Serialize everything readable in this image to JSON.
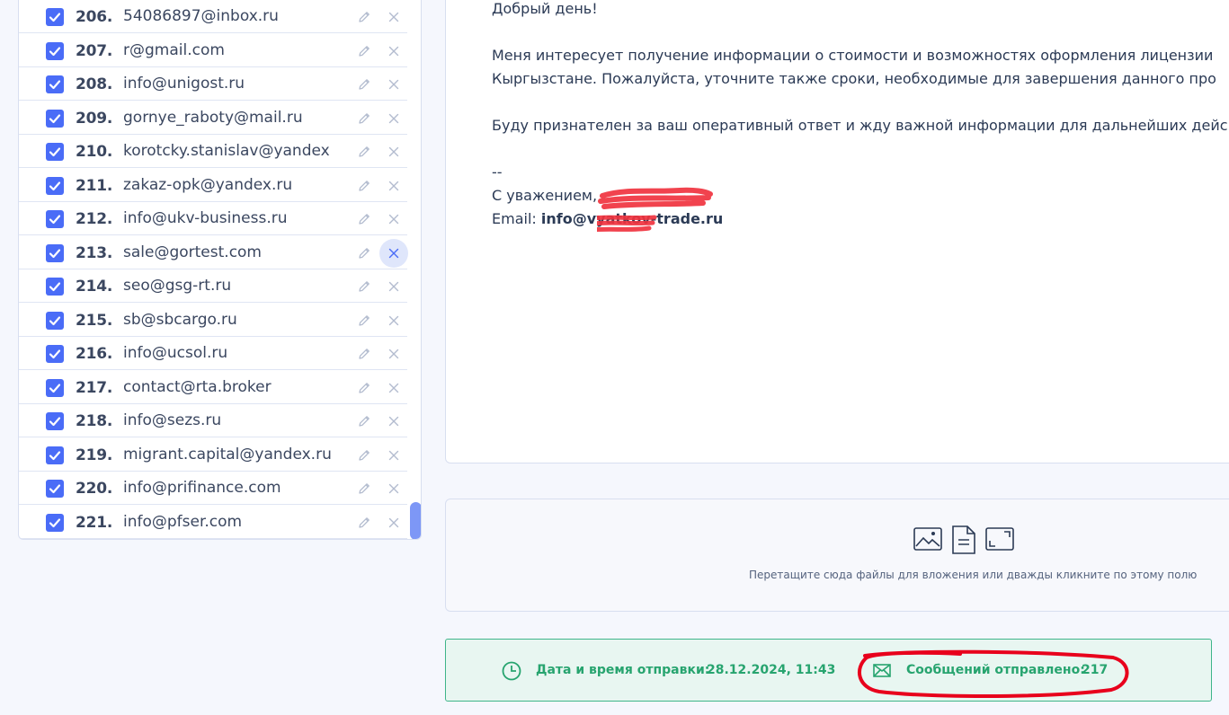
{
  "recipients": {
    "rows": [
      {
        "num": "206.",
        "email": "54086897@inbox.ru"
      },
      {
        "num": "207.",
        "email": "r@gmail.com"
      },
      {
        "num": "208.",
        "email": "info@unigost.ru"
      },
      {
        "num": "209.",
        "email": "gornye_raboty@mail.ru"
      },
      {
        "num": "210.",
        "email": "korotcky.stanislav@yandex"
      },
      {
        "num": "211.",
        "email": "zakaz-opk@yandex.ru"
      },
      {
        "num": "212.",
        "email": "info@ukv-business.ru"
      },
      {
        "num": "213.",
        "email": "sale@gortest.com"
      },
      {
        "num": "214.",
        "email": "seo@gsg-rt.ru"
      },
      {
        "num": "215.",
        "email": "sb@sbcargo.ru"
      },
      {
        "num": "216.",
        "email": "info@ucsol.ru"
      },
      {
        "num": "217.",
        "email": "contact@rta.broker"
      },
      {
        "num": "218.",
        "email": "info@sezs.ru"
      },
      {
        "num": "219.",
        "email": "migrant.capital@yandex.ru"
      },
      {
        "num": "220.",
        "email": "info@prifinance.com"
      },
      {
        "num": "221.",
        "email": "info@pfser.com"
      }
    ],
    "hovered_row_num": "213."
  },
  "message": {
    "greeting": "Добрый день!",
    "para1_line1": "Меня интересует получение информации о стоимости и возможностях оформления лицензии",
    "para1_line2": "Кыргызстане. Пожалуйста, уточните также сроки, необходимые для завершения данного про",
    "para2": "Буду признателен за ваш оперативный ответ и жду важной информации для дальнейших дейс",
    "sig_sep": "--",
    "sig_regards": "С уважением,",
    "sig_email_label": "Email:",
    "sig_email_value": "info@vyatkov-trade.ru"
  },
  "attachments": {
    "hint": "Перетащите сюда файлы для вложения или дважды кликните по этому полю",
    "icons": [
      "image-icon",
      "document-icon",
      "expand-icon"
    ]
  },
  "status": {
    "sent_time_label": "Дата и время отправки:",
    "sent_time_value": "28.12.2024, 11:43",
    "sent_count_label": "Сообщений отправлено:",
    "sent_count_value": "217"
  },
  "colors": {
    "checkbox": "#4a6cf7",
    "status_green": "#27a46f",
    "annotation_red": "#e8001c",
    "redaction_red": "#f0333f"
  }
}
